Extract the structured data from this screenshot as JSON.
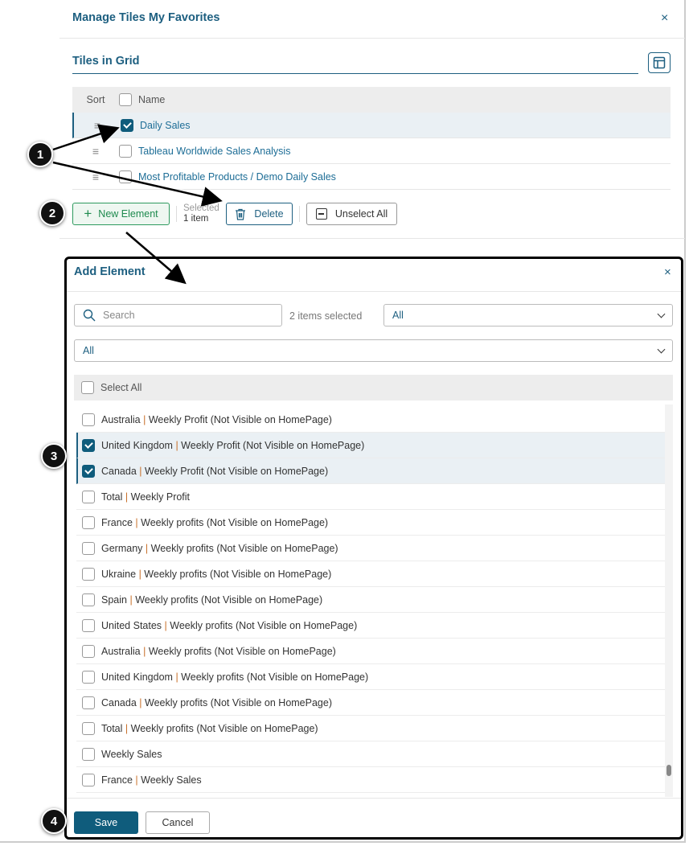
{
  "manage": {
    "title": "Manage Tiles My Favorites",
    "close": "×",
    "tab": "Tiles in Grid",
    "header": {
      "sort": "Sort",
      "name": "Name"
    },
    "rows": [
      {
        "name": "Daily Sales",
        "checked": true
      },
      {
        "name": "Tableau Worldwide Sales Analysis",
        "checked": false
      },
      {
        "name": "Most Profitable Products / Demo Daily Sales",
        "checked": false
      }
    ],
    "new_element": "New Element",
    "selected_label": "Selected",
    "selected_count": "1 item",
    "delete": "Delete",
    "unselect_all": "Unselect All"
  },
  "dialog": {
    "title": "Add Element",
    "close": "×",
    "search_placeholder": "Search",
    "items_selected": "2 items selected",
    "filter1": "All",
    "filter2": "All",
    "select_all": "Select All",
    "items": [
      {
        "a": "Australia",
        "b": "Weekly Profit (Not Visible on HomePage)",
        "checked": false
      },
      {
        "a": "United Kingdom",
        "b": "Weekly Profit (Not Visible on HomePage)",
        "checked": true
      },
      {
        "a": "Canada",
        "b": "Weekly Profit (Not Visible on HomePage)",
        "checked": true
      },
      {
        "a": "Total",
        "b": "Weekly Profit",
        "checked": false
      },
      {
        "a": "France",
        "b": "Weekly profits (Not Visible on HomePage)",
        "checked": false
      },
      {
        "a": "Germany",
        "b": "Weekly profits (Not Visible on HomePage)",
        "checked": false
      },
      {
        "a": "Ukraine",
        "b": "Weekly profits (Not Visible on HomePage)",
        "checked": false
      },
      {
        "a": "Spain",
        "b": "Weekly profits (Not Visible on HomePage)",
        "checked": false
      },
      {
        "a": "United States",
        "b": "Weekly profits (Not Visible on HomePage)",
        "checked": false
      },
      {
        "a": "Australia",
        "b": "Weekly profits (Not Visible on HomePage)",
        "checked": false
      },
      {
        "a": "United Kingdom",
        "b": "Weekly profits (Not Visible on HomePage)",
        "checked": false
      },
      {
        "a": "Canada",
        "b": "Weekly profits (Not Visible on HomePage)",
        "checked": false
      },
      {
        "a": "Total",
        "b": "Weekly profits (Not Visible on HomePage)",
        "checked": false
      },
      {
        "a": "",
        "b": "Weekly Sales",
        "checked": false
      },
      {
        "a": "France",
        "b": "Weekly Sales",
        "checked": false
      }
    ],
    "save": "Save",
    "cancel": "Cancel"
  },
  "callouts": [
    "1",
    "2",
    "3",
    "4"
  ],
  "colors": {
    "accent": "#1d5f80",
    "primary": "#0f5c7c",
    "separator": "#c8702a",
    "green": "#1e8a4e"
  }
}
